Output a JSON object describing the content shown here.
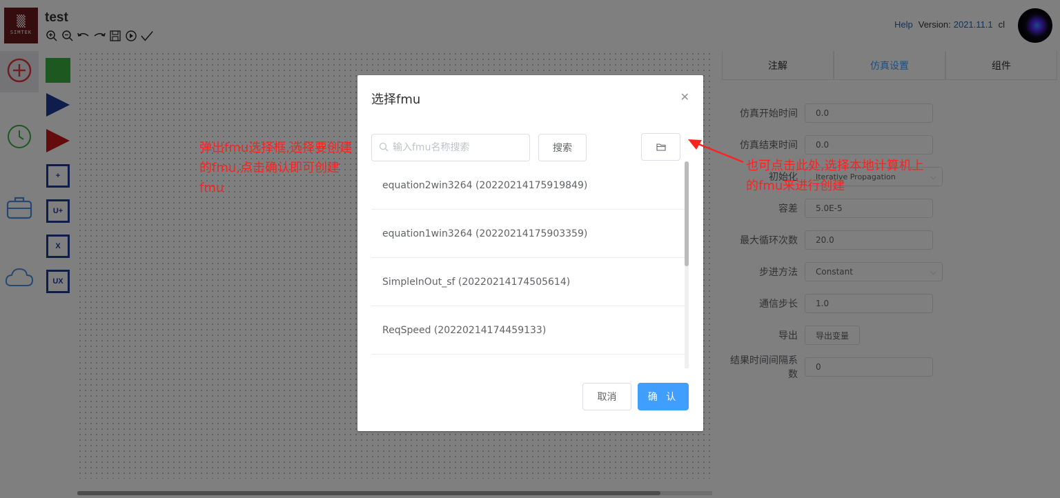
{
  "header": {
    "logo_text": "SIMTEK",
    "title": "test",
    "help_label": "Help",
    "version_label": "Version:",
    "version_value": "2021.11.1",
    "user": "cl"
  },
  "toolbar": {
    "icons": [
      "zoom-in-icon",
      "zoom-out-icon",
      "undo-icon",
      "redo-icon",
      "save-icon",
      "run-icon",
      "check-icon"
    ]
  },
  "left_nav": {
    "icons": [
      "add-circle-icon",
      "clock-icon",
      "briefcase-icon",
      "cloud-icon"
    ]
  },
  "palette": {
    "blocks": [
      "+",
      "U+",
      "X",
      "UX"
    ]
  },
  "right_panel": {
    "tabs": [
      {
        "label": "注解"
      },
      {
        "label": "仿真设置"
      },
      {
        "label": "组件"
      }
    ],
    "active_tab": "仿真设置",
    "fields": {
      "start_time": {
        "label": "仿真开始时间",
        "value": "0.0"
      },
      "end_time": {
        "label": "仿真结束时间",
        "value": "0.0"
      },
      "init": {
        "label": "初始化",
        "value": "Iterative Propagation"
      },
      "tolerance": {
        "label": "容差",
        "value": "5.0E-5"
      },
      "max_loops": {
        "label": "最大循环次数",
        "value": "20.0"
      },
      "step_method": {
        "label": "步进方法",
        "value": "Constant"
      },
      "comm_step": {
        "label": "通信步长",
        "value": "1.0"
      },
      "export": {
        "label": "导出",
        "button": "导出变量"
      },
      "result_interval": {
        "label": "结果时间间隔系数",
        "value": "0"
      }
    }
  },
  "dialog": {
    "title": "选择fmu",
    "search_placeholder": "输入fmu名称搜索",
    "search_button": "搜索",
    "items": [
      "equation2win3264 (20220214175919849)",
      "equation1win3264 (20220214175903359)",
      "SimpleInOut_sf (20220214174505614)",
      "ReqSpeed (20220214174459133)",
      ""
    ],
    "cancel": "取消",
    "confirm": "确 认"
  },
  "annotations": {
    "left": "弹出fmu选择框,选择要创建的fmu,点击确认即可创建fmu",
    "right": "也可点击此处,选择本地计算机上的fmu来进行创建",
    "color": "#ff2020"
  },
  "colors": {
    "accent": "#409eff",
    "block_blue": "#1f3a9a",
    "block_red": "#c8161d",
    "block_green": "#3cb043",
    "logo_bg": "#6b1a1f"
  }
}
